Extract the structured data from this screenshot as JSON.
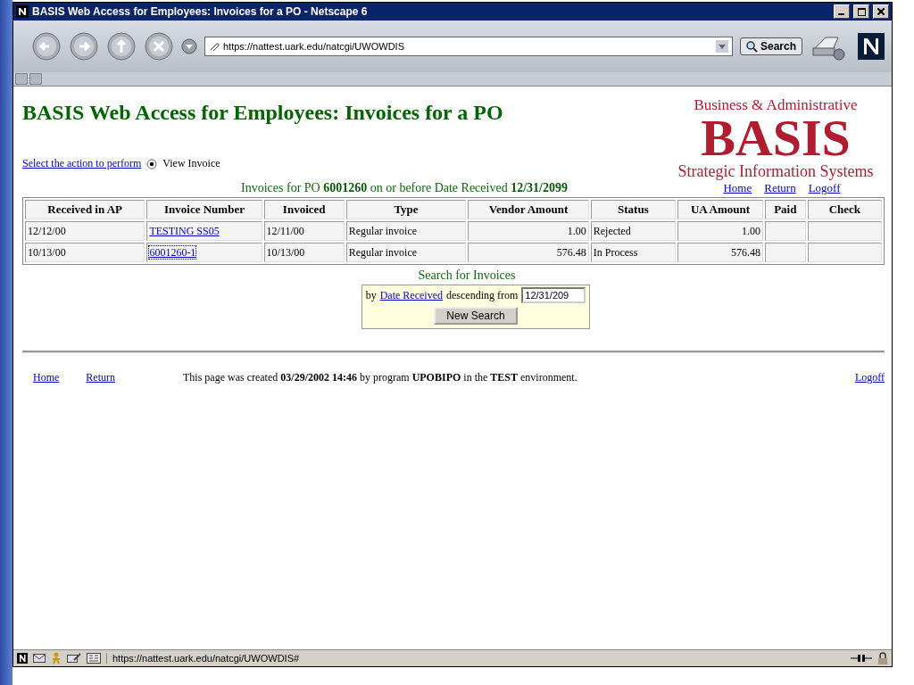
{
  "window": {
    "title": "BASIS Web Access for Employees: Invoices for a PO - Netscape 6"
  },
  "toolbar": {
    "url": "https://nattest.uark.edu/natcgi/UWOWDIS",
    "search_button": "Search"
  },
  "page": {
    "heading": "BASIS Web Access for Employees: Invoices for a PO",
    "logo": {
      "top": "Business & Administrative",
      "main": "BASIS",
      "bottom": "Strategic Information Systems"
    },
    "action": {
      "link": "Select the action to perform",
      "options": [
        {
          "label": "View Invoice",
          "selected": true
        }
      ]
    },
    "caption": "Invoices for PO **6001260** on or before Date Received **12/31/2099**",
    "top_links": [
      "Home",
      "Return",
      "Logoff"
    ],
    "table": {
      "columns": [
        "Received in AP",
        "Invoice Number",
        "Invoiced",
        "Type",
        "Vendor Amount",
        "Status",
        "UA Amount",
        "Paid",
        "Check"
      ],
      "rows": [
        {
          "received": "12/12/00",
          "invoice": "TESTING SS05",
          "invoiced": "12/11/00",
          "type": "Regular invoice",
          "vendor_amount": "1.00",
          "status": "Rejected",
          "ua_amount": "1.00",
          "focused": false
        },
        {
          "received": "10/13/00",
          "invoice": "6001260-1",
          "invoiced": "10/13/00",
          "type": "Regular invoice",
          "vendor_amount": "576.48",
          "status": "In Process",
          "ua_amount": "576.48",
          "focused": true
        }
      ]
    },
    "search": {
      "title": "Search for Invoices",
      "prefix": "by",
      "link": "Date Received",
      "middle": "descending from",
      "value": "12/31/209",
      "button": "New Search"
    },
    "footer": {
      "links_left": [
        "Home",
        "Return"
      ],
      "text": "This page was created **03/29/2002 14:46** by program **UPOBIPO** in the **TEST** environment.",
      "link_right": "Logoff"
    }
  },
  "status_bar": {
    "url": "https://nattest.uark.edu/natcgi/UWOWDIS#"
  }
}
